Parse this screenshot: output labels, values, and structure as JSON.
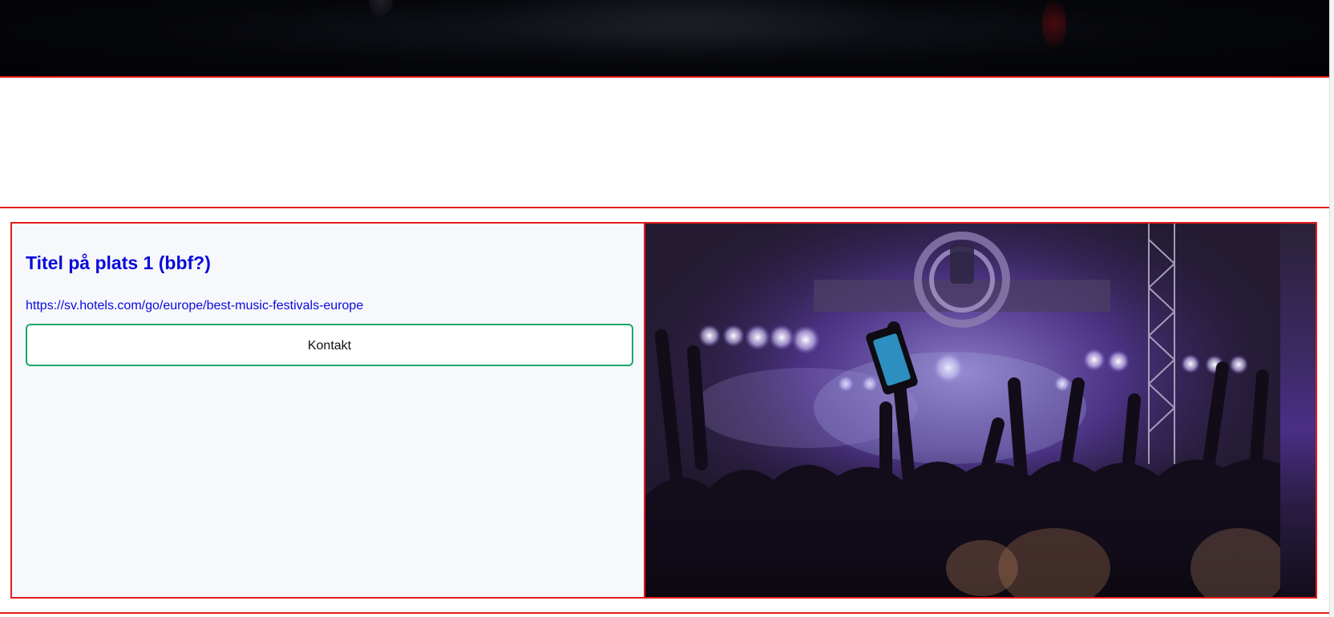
{
  "card": {
    "title": "Titel på plats 1 (bbf?)",
    "link_text": "https://sv.hotels.com/go/europe/best-music-festivals-europe",
    "contact_button_label": "Kontakt",
    "image_alt": "Concert crowd with raised hands in front of a purple-lit stage"
  },
  "colors": {
    "accent_border": "#e51c1c",
    "title_link": "#0a0adc",
    "button_border": "#1aa86b",
    "card_background": "#f7f8fc"
  }
}
